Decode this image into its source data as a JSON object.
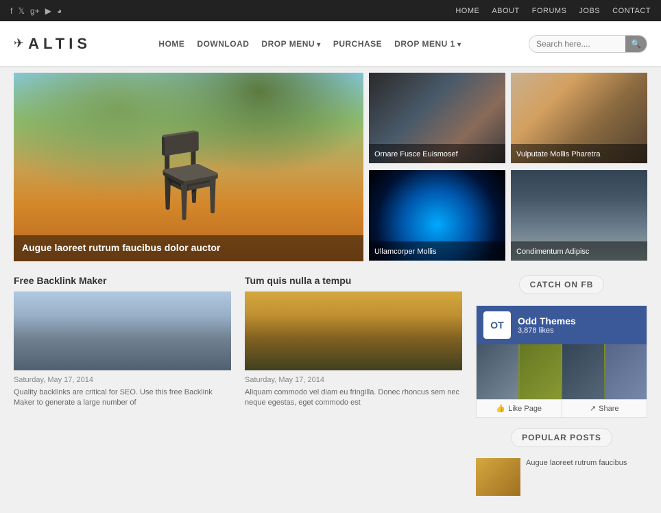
{
  "topbar": {
    "social": [
      {
        "name": "facebook",
        "icon": "f"
      },
      {
        "name": "twitter",
        "icon": "t"
      },
      {
        "name": "googleplus",
        "icon": "g+"
      },
      {
        "name": "youtube",
        "icon": "▶"
      },
      {
        "name": "rss",
        "icon": "◉"
      }
    ],
    "nav": [
      {
        "label": "HOME",
        "href": "#"
      },
      {
        "label": "ABOUT",
        "href": "#"
      },
      {
        "label": "FORUMS",
        "href": "#"
      },
      {
        "label": "JOBS",
        "href": "#"
      },
      {
        "label": "CONTACT",
        "href": "#"
      }
    ]
  },
  "mainnav": {
    "logo_text": "ALTIS",
    "menu": [
      {
        "label": "HOME",
        "dropdown": false
      },
      {
        "label": "DOWNLOAD",
        "dropdown": false
      },
      {
        "label": "DROP MENU",
        "dropdown": true
      },
      {
        "label": "PURCHASE",
        "dropdown": false
      },
      {
        "label": "DROP MENU 1",
        "dropdown": true
      }
    ],
    "search_placeholder": "Search here...."
  },
  "hero": {
    "main": {
      "caption": "Augue laoreet rutrum faucibus dolor auctor"
    },
    "thumbs": [
      {
        "caption": "Ornare Fusce Euismosef"
      },
      {
        "caption": "Vulputate Mollis Pharetra"
      },
      {
        "caption": "Ullamcorper Mollis"
      },
      {
        "caption": "Condimentum Adipisc"
      }
    ]
  },
  "posts": [
    {
      "title": "Free Backlink Maker",
      "date": "Saturday, May 17, 2014",
      "excerpt": "Quality backlinks are critical for SEO. Use this free Backlink Maker to generate a large number of"
    },
    {
      "title": "Tum quis nulla a tempu",
      "date": "Saturday, May 17, 2014",
      "excerpt": "Aliquam commodo vel diam eu fringilla. Donec rhoncus sem nec neque egestas, eget commodo est"
    }
  ],
  "sidebar": {
    "facebook": {
      "widget_title": "CATCH ON FB",
      "page_name": "Odd Themes",
      "likes": "3,878 likes",
      "like_button": "Like Page",
      "share_button": "Share"
    },
    "popular_posts": {
      "widget_title": "POPULAR POSTS",
      "items": [
        {
          "text": "Augue laoreet rutrum faucibus"
        }
      ]
    }
  }
}
